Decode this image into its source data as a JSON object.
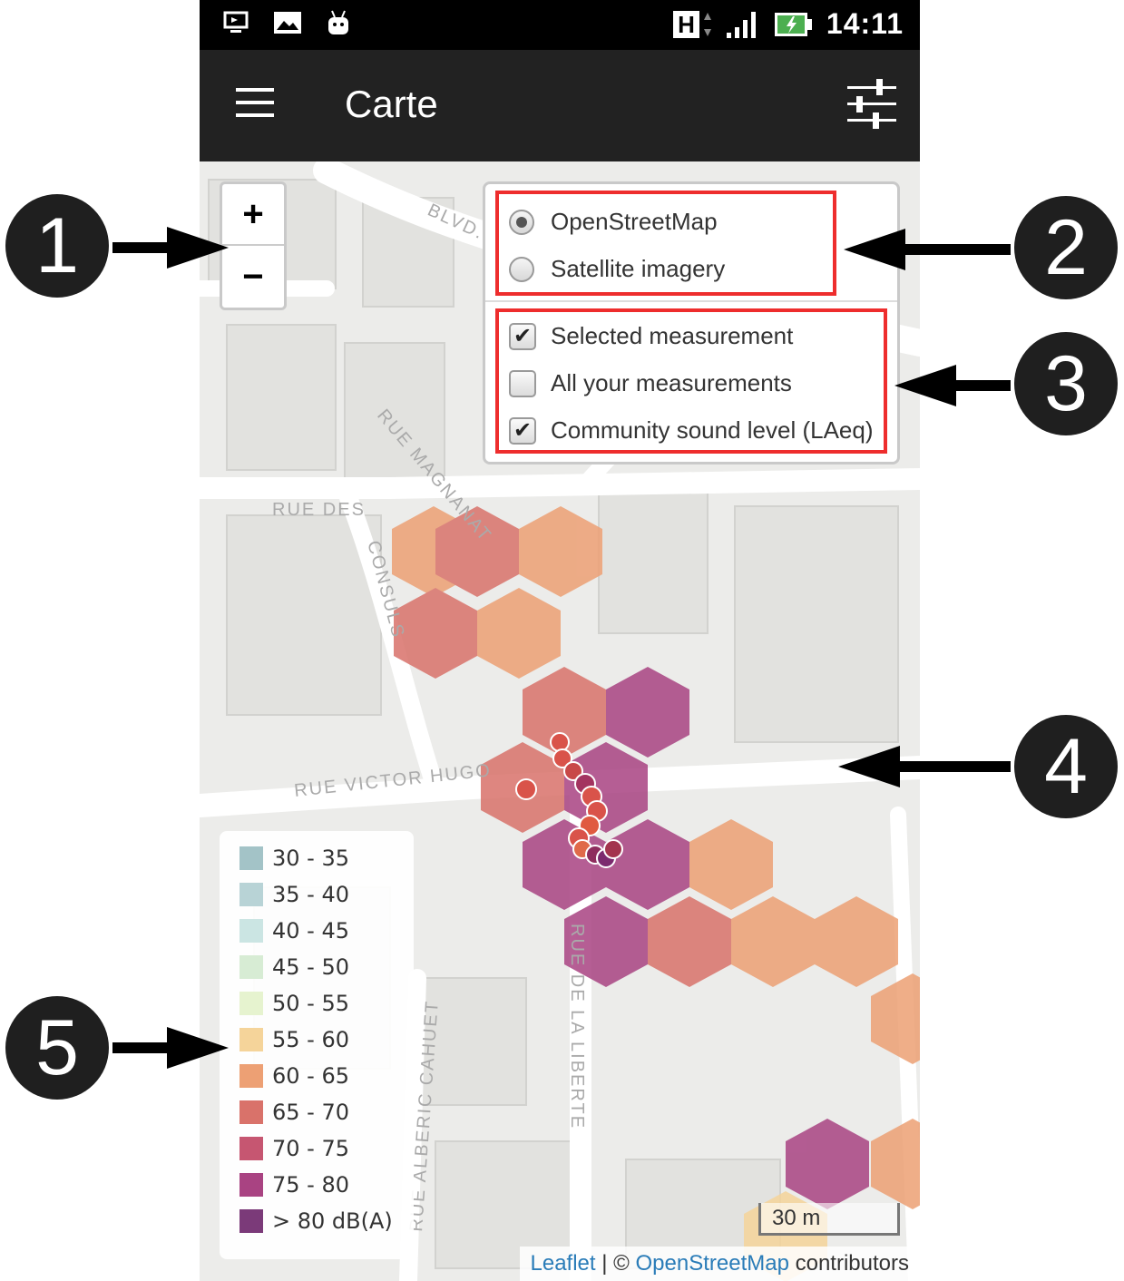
{
  "status_bar": {
    "time": "14:11",
    "network_type": "H",
    "icons": [
      "screen-cast-icon",
      "image-icon",
      "android-icon",
      "network-h-icon",
      "signal-icon",
      "battery-charging-icon"
    ]
  },
  "app_bar": {
    "title": "Carte",
    "menu_icon": "hamburger-menu-icon",
    "filter_icon": "sliders-filter-icon"
  },
  "map": {
    "zoom_in_label": "+",
    "zoom_out_label": "−",
    "street_labels": [
      "BLVD.",
      "RUE MAGNANAT",
      "RUE DES CONSULS",
      "RUE VICTOR HUGO",
      "RUE DE LA LIBERTE",
      "RUE ALBERIC CAHUET"
    ],
    "layer_control": {
      "base_layers": [
        {
          "label": "OpenStreetMap",
          "selected": true
        },
        {
          "label": "Satellite imagery",
          "selected": false
        }
      ],
      "overlays": [
        {
          "label": "Selected measurement",
          "checked": true
        },
        {
          "label": "All your measurements",
          "checked": false
        },
        {
          "label": "Community sound level (LAeq)",
          "checked": true
        }
      ]
    },
    "legend": [
      {
        "label": "30 - 35",
        "color": "#a3c3c7"
      },
      {
        "label": "35 - 40",
        "color": "#b8d3d6"
      },
      {
        "label": "40 - 45",
        "color": "#cbe5e3"
      },
      {
        "label": "45 - 50",
        "color": "#d7ecd4"
      },
      {
        "label": "50 - 55",
        "color": "#e6f3cf"
      },
      {
        "label": "55 - 60",
        "color": "#f5d49a"
      },
      {
        "label": "60 - 65",
        "color": "#eda074"
      },
      {
        "label": "65 - 70",
        "color": "#d9726a"
      },
      {
        "label": "70 - 75",
        "color": "#c65671"
      },
      {
        "label": "75 - 80",
        "color": "#a94382"
      },
      {
        "label": "> 80 dB(A)",
        "color": "#7b3a79"
      }
    ],
    "scale_label": "30 m",
    "attribution": {
      "leaflet": "Leaflet",
      "separator": " | © ",
      "osm": "OpenStreetMap",
      "suffix": " contributors"
    }
  },
  "callouts": [
    "1",
    "2",
    "3",
    "4",
    "5"
  ]
}
